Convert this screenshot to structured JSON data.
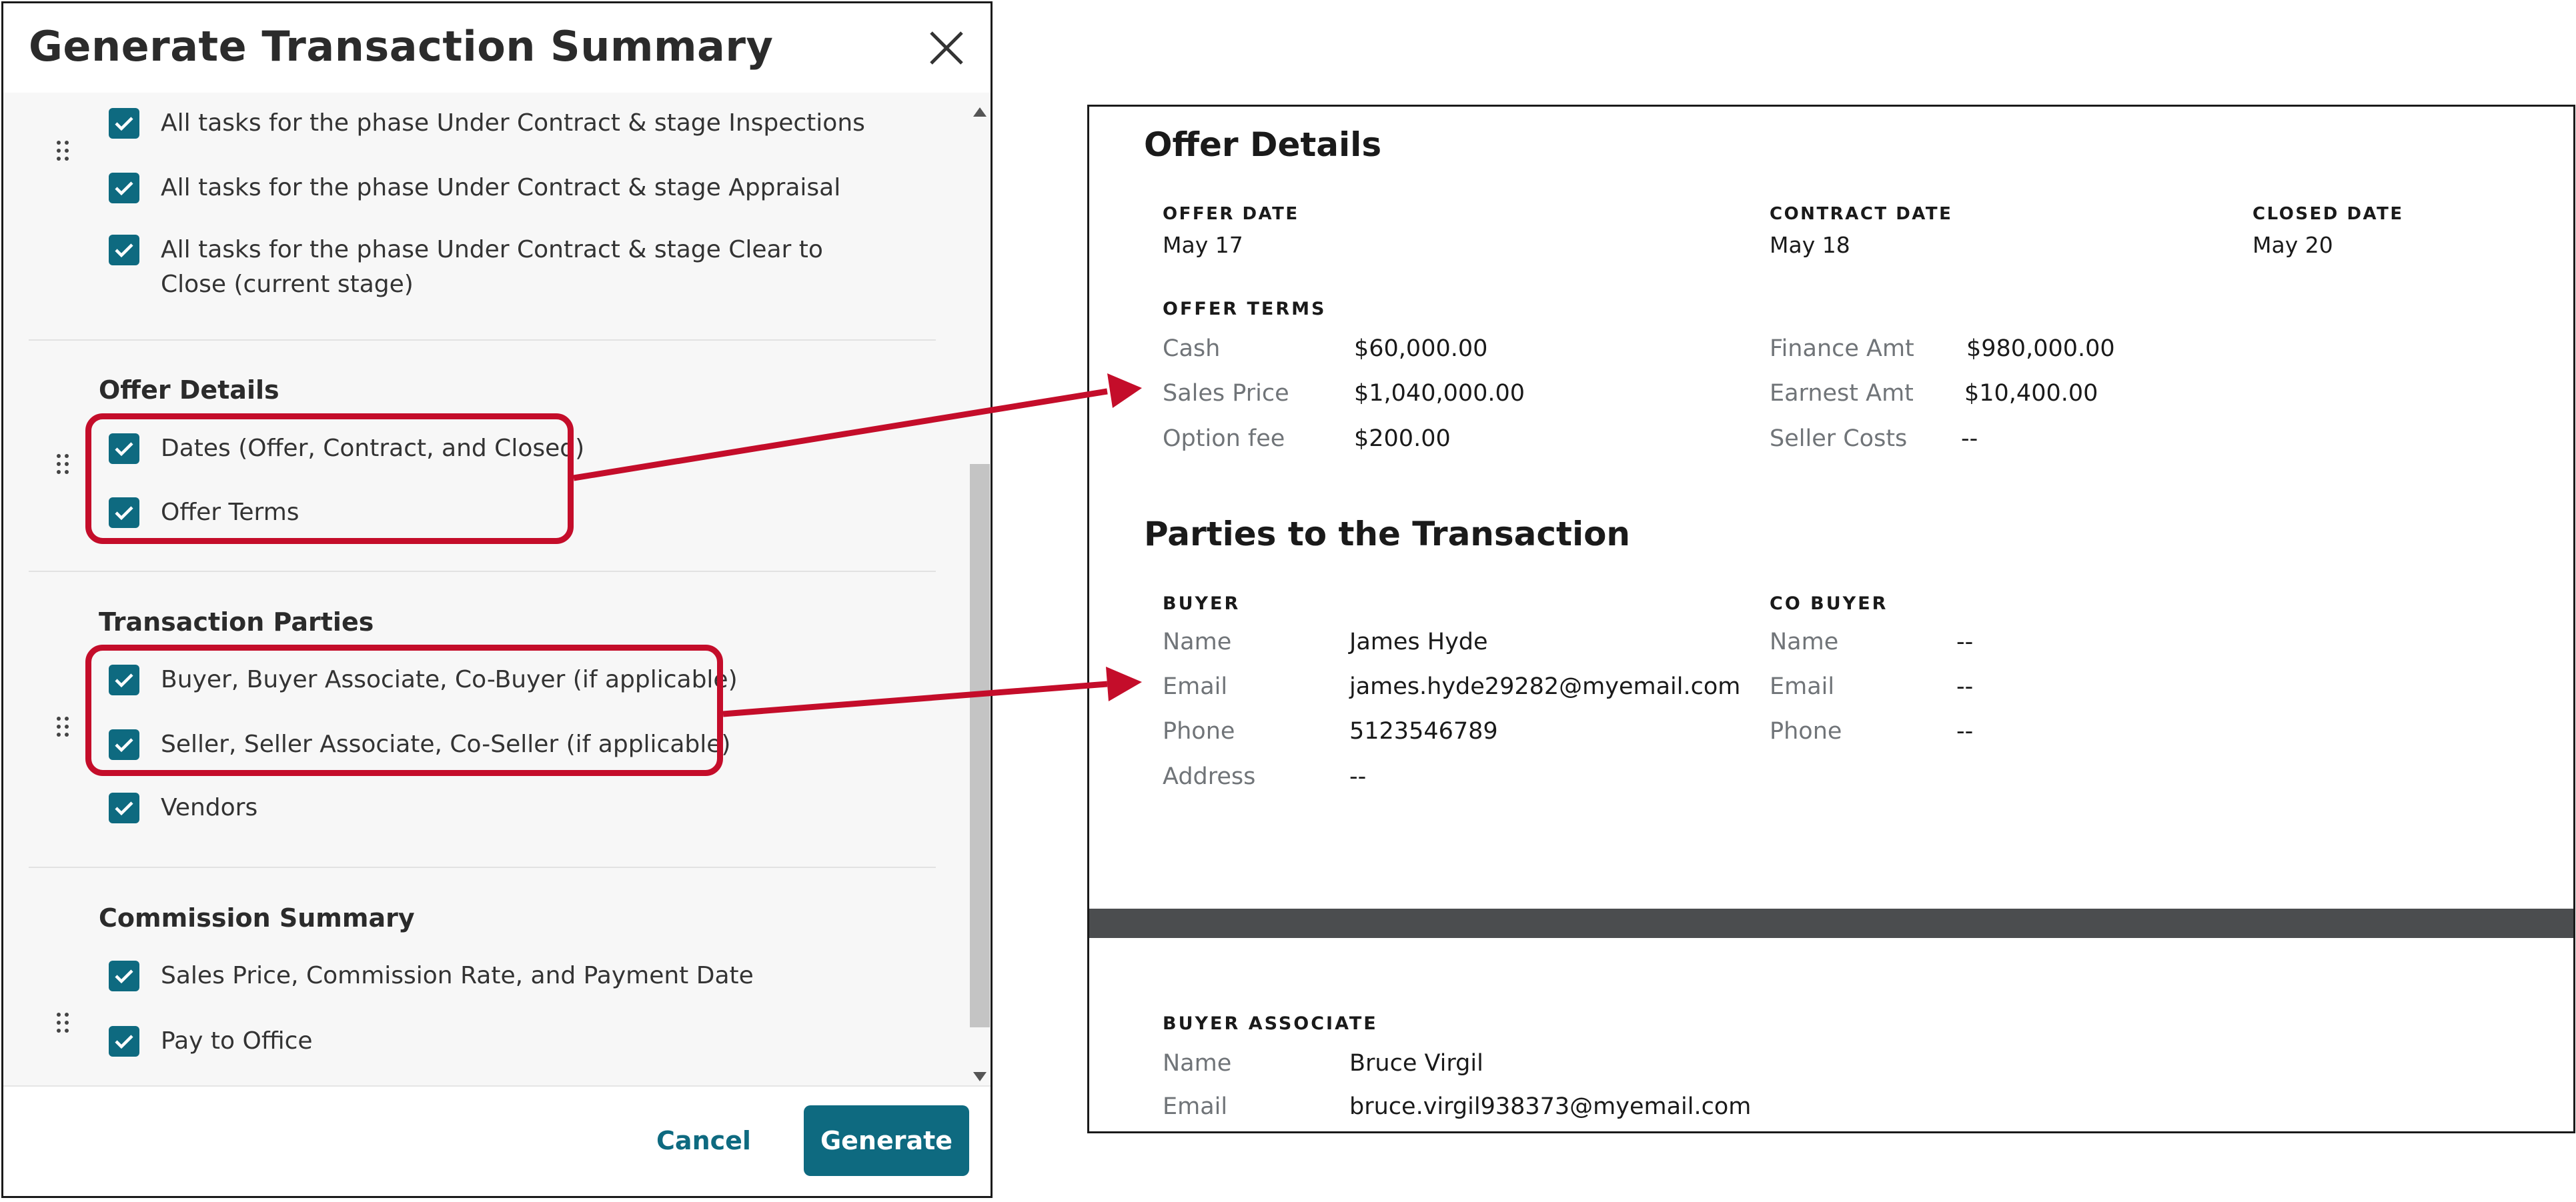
{
  "modal": {
    "title": "Generate Transaction Summary",
    "tasks": [
      "All tasks for the phase Under Contract & stage Inspections",
      "All tasks for the phase Under Contract & stage Appraisal",
      "All tasks for the phase Under Contract & stage Clear to Close (current stage)"
    ],
    "offer_details": {
      "title": "Offer Details",
      "items": [
        "Dates (Offer, Contract, and Closed)",
        "Offer Terms"
      ]
    },
    "transaction_parties": {
      "title": "Transaction Parties",
      "items": [
        "Buyer, Buyer Associate, Co-Buyer (if applicable)",
        "Seller, Seller Associate, Co-Seller (if applicable)",
        "Vendors"
      ]
    },
    "commission_summary": {
      "title": "Commission Summary",
      "items": [
        "Sales Price, Commission Rate, and Payment Date",
        "Pay to Office"
      ]
    },
    "cancel_label": "Cancel",
    "generate_label": "Generate"
  },
  "colors": {
    "accent": "#0e6a80",
    "highlight": "#c40d2a"
  },
  "preview": {
    "offer_details": {
      "title": "Offer Details",
      "offer_date_label": "OFFER DATE",
      "offer_date": "May 17",
      "contract_date_label": "CONTRACT DATE",
      "contract_date": "May 18",
      "closed_date_label": "CLOSED DATE",
      "closed_date": "May 20",
      "offer_terms_label": "OFFER TERMS",
      "terms": [
        {
          "label": "Cash",
          "value": "$60,000.00"
        },
        {
          "label": "Sales Price",
          "value": "$1,040,000.00"
        },
        {
          "label": "Option fee",
          "value": "$200.00"
        },
        {
          "label": "Finance Amt",
          "value": "$980,000.00"
        },
        {
          "label": "Earnest Amt",
          "value": "$10,400.00"
        },
        {
          "label": "Seller Costs",
          "value": "--"
        }
      ]
    },
    "parties": {
      "title": "Parties to the Transaction",
      "buyer_label": "BUYER",
      "buyer": [
        {
          "label": "Name",
          "value": "James Hyde"
        },
        {
          "label": "Email",
          "value": "james.hyde29282@myemail.com"
        },
        {
          "label": "Phone",
          "value": "5123546789"
        },
        {
          "label": "Address",
          "value": "--"
        }
      ],
      "co_buyer_label": "CO BUYER",
      "co_buyer": [
        {
          "label": "Name",
          "value": "--"
        },
        {
          "label": "Email",
          "value": "--"
        },
        {
          "label": "Phone",
          "value": "--"
        }
      ],
      "buyer_associate_label": "BUYER ASSOCIATE",
      "buyer_associate": [
        {
          "label": "Name",
          "value": "Bruce Virgil"
        },
        {
          "label": "Email",
          "value": "bruce.virgil938373@myemail.com"
        }
      ]
    }
  }
}
